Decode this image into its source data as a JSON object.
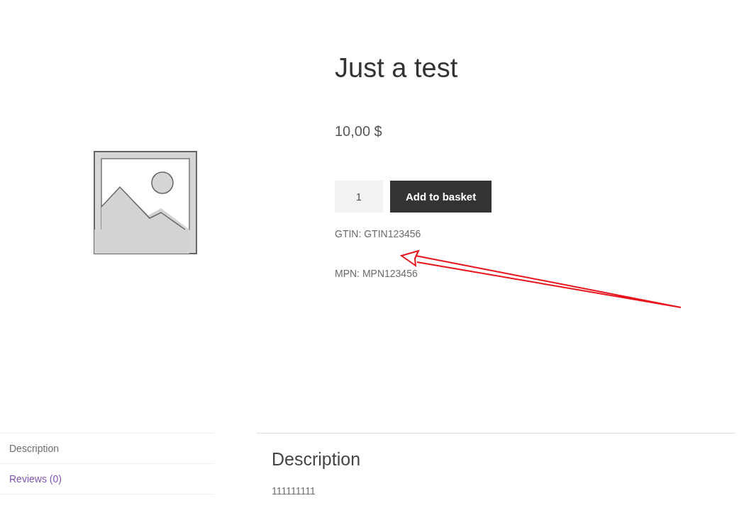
{
  "product": {
    "title": "Just a test",
    "price": "10,00 $",
    "quantity": "1",
    "add_button": "Add to basket",
    "meta": [
      {
        "label": "GTIN: GTIN123456"
      },
      {
        "label": "MPN: MPN123456"
      }
    ]
  },
  "tabs": [
    {
      "label": "Description",
      "selected": true
    },
    {
      "label": "Reviews (0)",
      "selected": false
    }
  ],
  "panel": {
    "heading": "Description",
    "body": "111111111"
  },
  "annotation": {
    "kind": "arrow"
  }
}
